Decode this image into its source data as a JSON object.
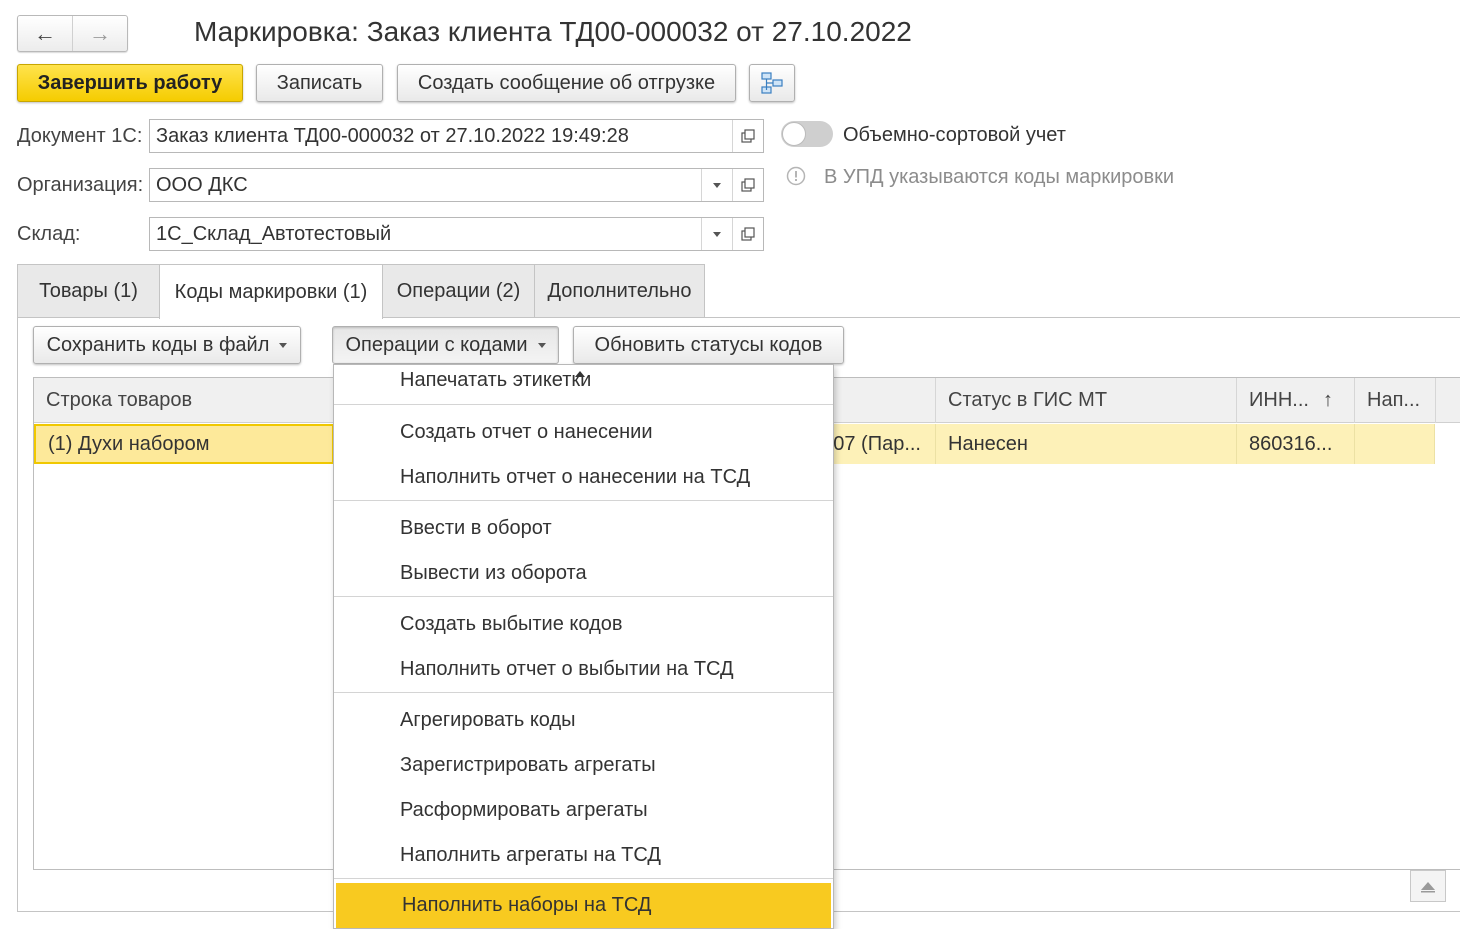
{
  "window": {
    "title": "Маркировка: Заказ клиента ТД00-000032 от 27.10.2022"
  },
  "nav": {
    "back": "←",
    "forward": "→"
  },
  "toolbar": {
    "finish": "Завершить работу",
    "save": "Записать",
    "create_message": "Создать сообщение об отгрузке"
  },
  "fields": {
    "document": {
      "label": "Документ 1С:",
      "value": "Заказ клиента ТД00-000032 от 27.10.2022 19:49:28"
    },
    "organization": {
      "label": "Организация:",
      "value": "ООО ДКС"
    },
    "warehouse": {
      "label": "Склад:",
      "value": "1С_Склад_Автотестовый"
    }
  },
  "options": {
    "volume_sort_label": "Объемно-сортовой учет",
    "info_text": "В УПД указываются коды маркировки"
  },
  "tabs": [
    {
      "label": "Товары (1)"
    },
    {
      "label": "Коды маркировки (1)"
    },
    {
      "label": "Операции (2)"
    },
    {
      "label": "Дополнительно"
    }
  ],
  "panel_buttons": {
    "save_codes": "Сохранить коды в файл",
    "operations": "Операции с кодами",
    "update_statuses": "Обновить статусы кодов"
  },
  "table": {
    "columns": [
      "Строка товаров",
      "Статус в ГИС МТ",
      "ИНН...",
      "Нап..."
    ],
    "sort_indicator": "↑",
    "rows": [
      {
        "product": "(1) Духи набором",
        "code": "07 (Пар...",
        "status": "Нанесен",
        "inn": "860316...",
        "extra": ""
      }
    ]
  },
  "menu": {
    "items": [
      {
        "label": "Напечатать этикетки"
      },
      {
        "label": "Создать отчет о нанесении"
      },
      {
        "label": "Наполнить отчет о нанесении на ТСД"
      },
      {
        "label": "Ввести в оборот"
      },
      {
        "label": "Вывести из оборота"
      },
      {
        "label": "Создать выбытие кодов"
      },
      {
        "label": "Наполнить отчет о выбытии на ТСД"
      },
      {
        "label": "Агрегировать коды"
      },
      {
        "label": "Зарегистрировать агрегаты"
      },
      {
        "label": "Расформировать агрегаты"
      },
      {
        "label": "Наполнить агрегаты на ТСД"
      },
      {
        "label": "Наполнить наборы на ТСД"
      }
    ]
  },
  "colors": {
    "primary_button": "#f5cc00",
    "menu_highlight": "#f8ca20",
    "selected_row": "#fdf1b8"
  }
}
